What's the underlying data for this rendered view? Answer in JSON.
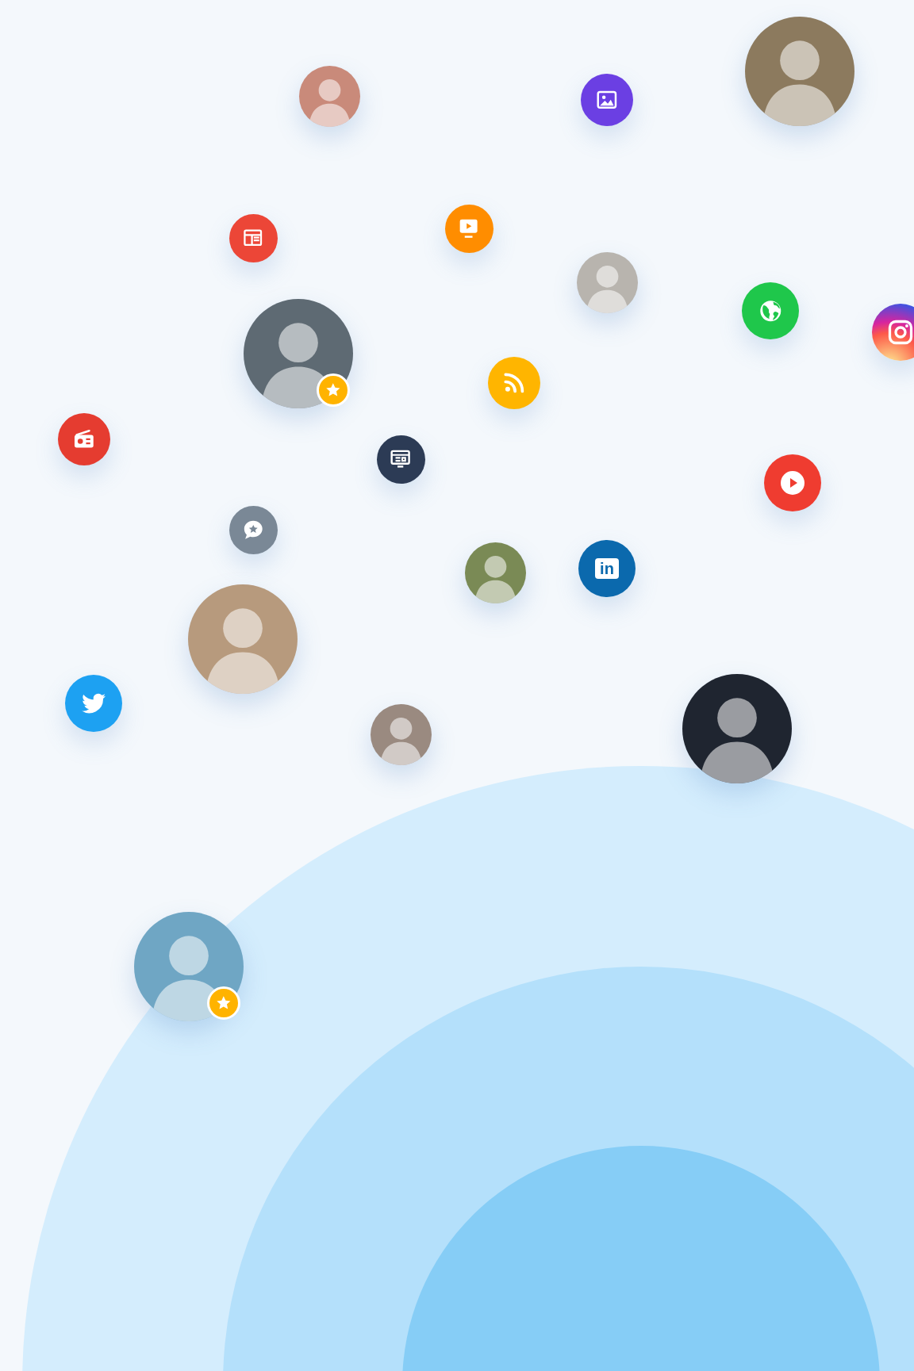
{
  "avatars": [
    {
      "starred": false
    },
    {
      "starred": false
    },
    {
      "starred": false
    },
    {
      "starred": true
    },
    {
      "starred": false
    },
    {
      "starred": false
    },
    {
      "starred": false
    },
    {
      "starred": false
    },
    {
      "starred": true
    }
  ],
  "icons": [
    {
      "kind": "image",
      "color": "#6b3fe3"
    },
    {
      "kind": "layout",
      "color": "#ec4637"
    },
    {
      "kind": "tv",
      "color": "#ff8d00"
    },
    {
      "kind": "globe",
      "color": "#1fc74b"
    },
    {
      "kind": "instagram"
    },
    {
      "kind": "rss",
      "color": "#ffb500"
    },
    {
      "kind": "radio",
      "color": "#e53c30"
    },
    {
      "kind": "monitor",
      "color": "#2c3b55"
    },
    {
      "kind": "play",
      "color": "#ef3c30"
    },
    {
      "kind": "chat",
      "color": "#7a8896"
    },
    {
      "kind": "linkedin",
      "color": "#0b69ad",
      "label": "in"
    },
    {
      "kind": "twitter",
      "color": "#1da1f2"
    }
  ]
}
